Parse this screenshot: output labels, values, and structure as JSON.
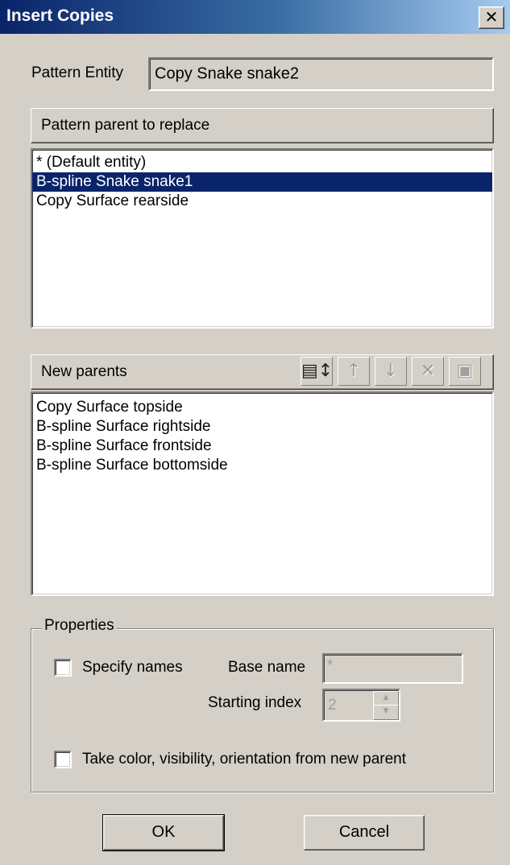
{
  "window": {
    "title": "Insert Copies",
    "close_icon": "close-icon",
    "close_glyph": "✕"
  },
  "pattern_entity": {
    "label": "Pattern Entity",
    "value": "Copy Snake snake2"
  },
  "pattern_parent": {
    "header": "Pattern parent to replace",
    "items": [
      {
        "label": "* (Default entity)",
        "selected": false
      },
      {
        "label": "B-spline Snake snake1",
        "selected": true
      },
      {
        "label": "Copy Surface rearside",
        "selected": false
      }
    ]
  },
  "new_parents": {
    "header": "New parents",
    "toolbar": [
      {
        "name": "select-parents-icon",
        "glyph": "▤↕",
        "enabled": true
      },
      {
        "name": "move-up-icon",
        "glyph": "↑",
        "enabled": false
      },
      {
        "name": "move-down-icon",
        "glyph": "↓",
        "enabled": false
      },
      {
        "name": "remove-icon",
        "glyph": "✕",
        "enabled": false
      },
      {
        "name": "clear-list-icon",
        "glyph": "▣",
        "enabled": false
      }
    ],
    "items": [
      "Copy Surface topside",
      "B-spline Surface rightside",
      "B-spline Surface frontside",
      "B-spline Surface bottomside"
    ]
  },
  "properties": {
    "legend": "Properties",
    "specify_names": {
      "label": "Specify names",
      "checked": false
    },
    "base_name": {
      "label": "Base name",
      "value": "*"
    },
    "starting_index": {
      "label": "Starting index",
      "value": "2"
    },
    "take_color": {
      "label": "Take color, visibility, orientation from new parent",
      "checked": false
    }
  },
  "buttons": {
    "ok": "OK",
    "cancel": "Cancel"
  },
  "colors": {
    "title_bar_start": "#0a246a",
    "title_bar_end": "#a6caf0",
    "selection": "#0a246a",
    "face": "#d4d0c8"
  }
}
